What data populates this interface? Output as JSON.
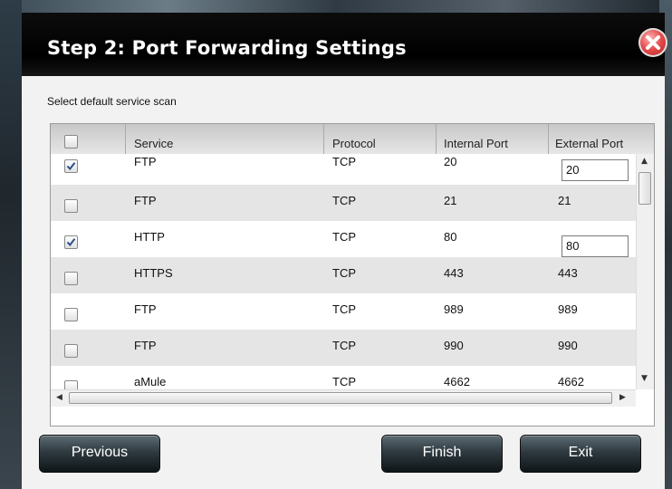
{
  "dialog": {
    "title": "Step 2: Port Forwarding Settings",
    "subtitle": "Select default service scan"
  },
  "table": {
    "headers": [
      "Service",
      "Protocol",
      "Internal Port",
      "External Port"
    ],
    "rows": [
      {
        "checked": true,
        "service": "FTP",
        "protocol": "TCP",
        "internal": "20",
        "external": "20",
        "editable": true
      },
      {
        "checked": false,
        "service": "FTP",
        "protocol": "TCP",
        "internal": "21",
        "external": "21",
        "editable": false
      },
      {
        "checked": true,
        "service": "HTTP",
        "protocol": "TCP",
        "internal": "80",
        "external": "80",
        "editable": true
      },
      {
        "checked": false,
        "service": "HTTPS",
        "protocol": "TCP",
        "internal": "443",
        "external": "443",
        "editable": false
      },
      {
        "checked": false,
        "service": "FTP",
        "protocol": "TCP",
        "internal": "989",
        "external": "989",
        "editable": false
      },
      {
        "checked": false,
        "service": "FTP",
        "protocol": "TCP",
        "internal": "990",
        "external": "990",
        "editable": false
      },
      {
        "checked": false,
        "service": "aMule",
        "protocol": "TCP",
        "internal": "4662",
        "external": "4662",
        "editable": false
      }
    ]
  },
  "buttons": {
    "previous": "Previous",
    "finish": "Finish",
    "exit": "Exit"
  },
  "icons": {
    "close": "close-icon",
    "check": "check-icon"
  },
  "colors": {
    "titlebar": "#000000",
    "close_button": "#d83a3a"
  }
}
